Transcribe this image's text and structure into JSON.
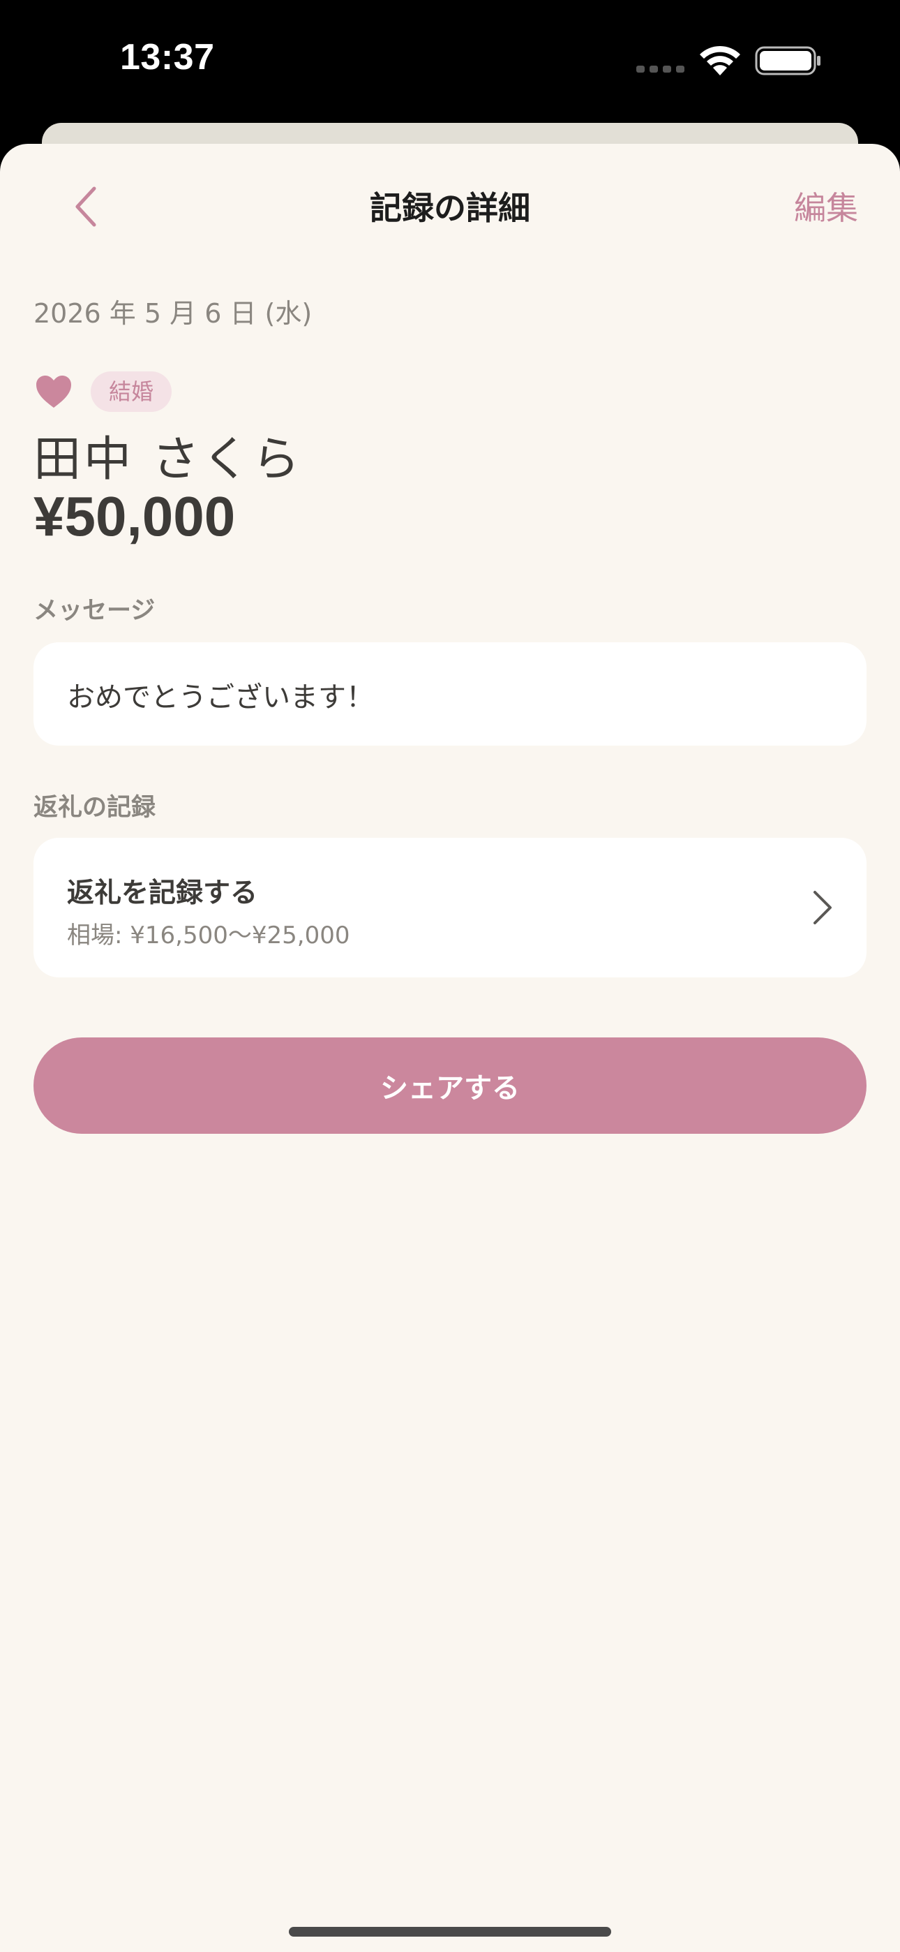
{
  "status_bar": {
    "time": "13:37"
  },
  "nav": {
    "back_icon": "chevron-left-icon",
    "title": "記録の詳細",
    "edit_label": "編集"
  },
  "record": {
    "date": "2026 年 5 月 6 日 (水)",
    "category_icon": "heart-icon",
    "category": "結婚",
    "name": "田中 さくら",
    "amount": "¥50,000"
  },
  "message_section": {
    "label": "メッセージ",
    "text": "おめでとうございます！"
  },
  "return_section": {
    "label": "返礼の記録",
    "action_title": "返礼を記録する",
    "range": "相場: ¥16,500〜¥25,000"
  },
  "share_button": {
    "label": "シェアする"
  },
  "colors": {
    "accent": "#cb879d",
    "accent_text": "#c6869c",
    "background": "#faf6f0",
    "card": "#ffffff",
    "text_primary": "#3d3b38",
    "text_secondary": "#8a8680"
  }
}
